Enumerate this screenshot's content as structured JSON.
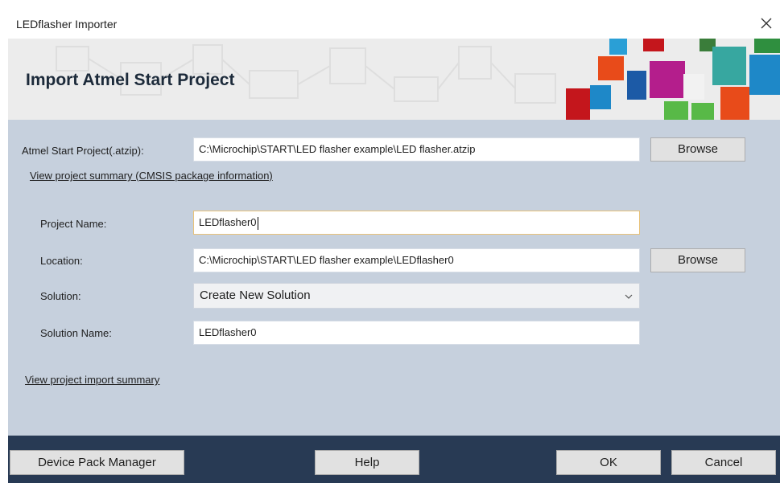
{
  "window": {
    "title": "LEDflasher Importer",
    "close_label": "✕"
  },
  "banner": {
    "heading": "Import Atmel Start Project"
  },
  "form": {
    "atzip_label": "Atmel Start Project(.atzip):",
    "atzip_value": "C:\\Microchip\\START\\LED flasher example\\LED flasher.atzip",
    "browse_label": "Browse",
    "summary_link": "View project summary (CMSIS package information)",
    "project_name_label": "Project Name:",
    "project_name_value": "LEDflasher0",
    "location_label": "Location:",
    "location_value": "C:\\Microchip\\START\\LED flasher example\\LEDflasher0",
    "solution_label": "Solution:",
    "solution_value": "Create New Solution",
    "solution_name_label": "Solution Name:",
    "solution_name_value": "LEDflasher0",
    "import_summary_link": "View project import summary"
  },
  "footer": {
    "device_pack_label": "Device Pack Manager",
    "help_label": "Help",
    "ok_label": "OK",
    "cancel_label": "Cancel"
  },
  "colors": {
    "content_bg": "#c6d0dd",
    "footer_bg": "#283a54",
    "active_border": "#e8c27a"
  },
  "icons": [
    "close-icon",
    "chevron-down-icon"
  ]
}
